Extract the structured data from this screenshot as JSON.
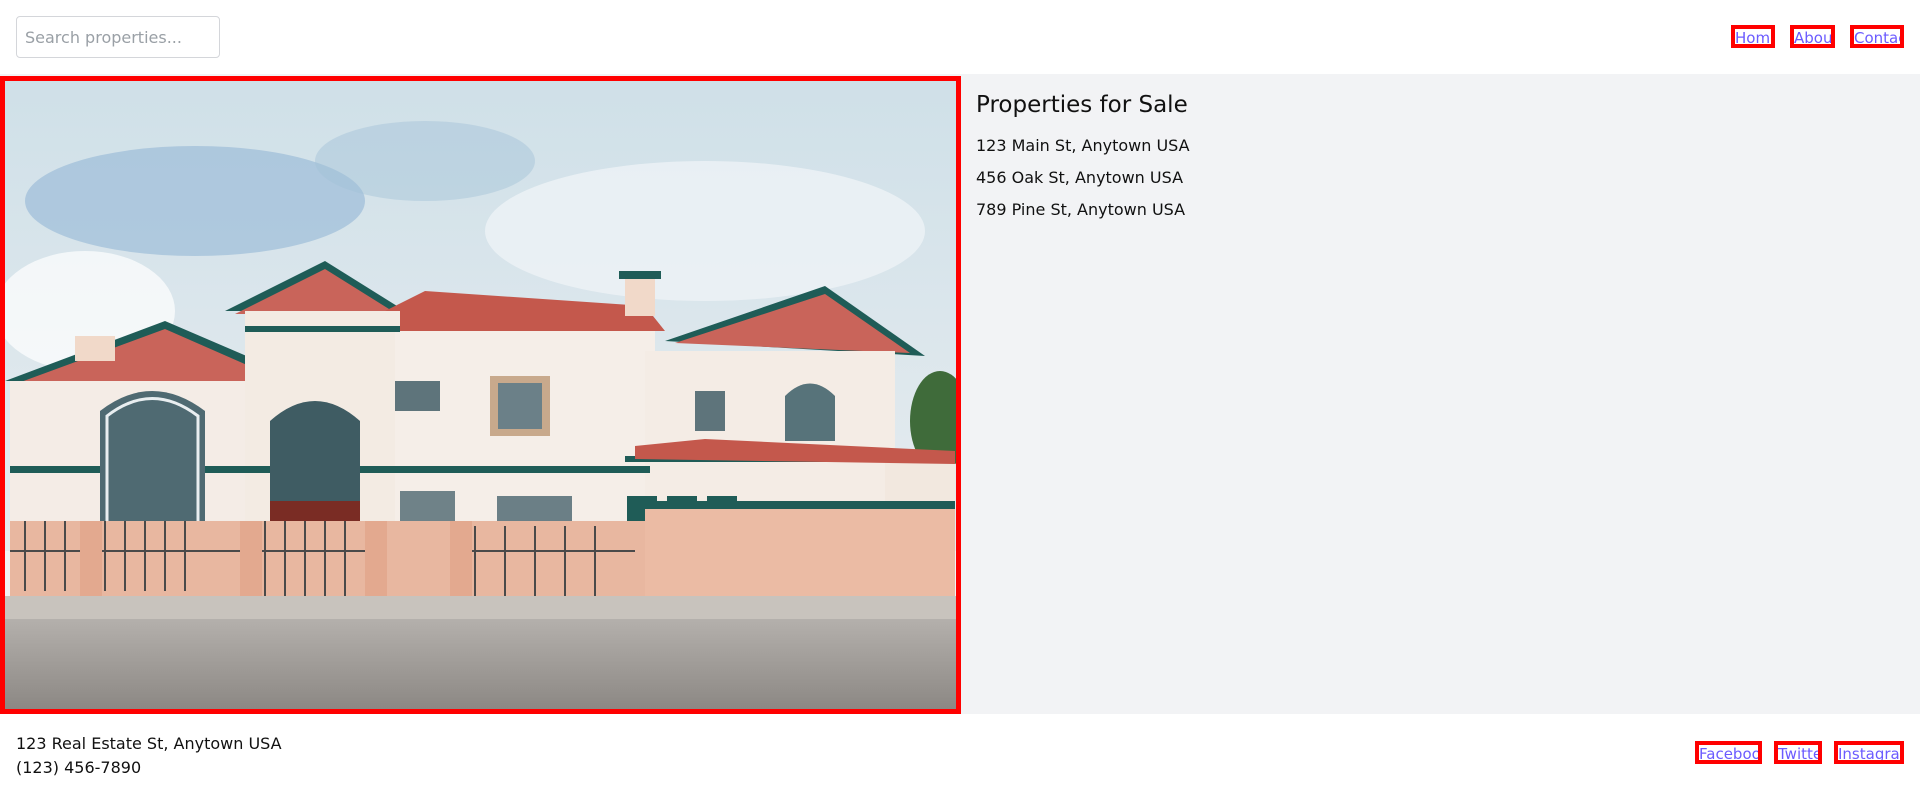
{
  "header": {
    "search_placeholder": "Search properties...",
    "nav": [
      "Home",
      "About",
      "Contact"
    ]
  },
  "main": {
    "image_alt": "Two-story stucco house with red tile roof",
    "title": "Properties for Sale",
    "listings": [
      "123 Main St, Anytown USA",
      "456 Oak St, Anytown USA",
      "789 Pine St, Anytown USA"
    ]
  },
  "footer": {
    "address": "123 Real Estate St, Anytown USA",
    "phone": "(123) 456-7890",
    "social": [
      "Facebook",
      "Twitter",
      "Instagram"
    ]
  },
  "colors": {
    "highlight_border": "#ff0000",
    "link": "#6b5bff",
    "panel_bg": "#f2f3f5"
  }
}
